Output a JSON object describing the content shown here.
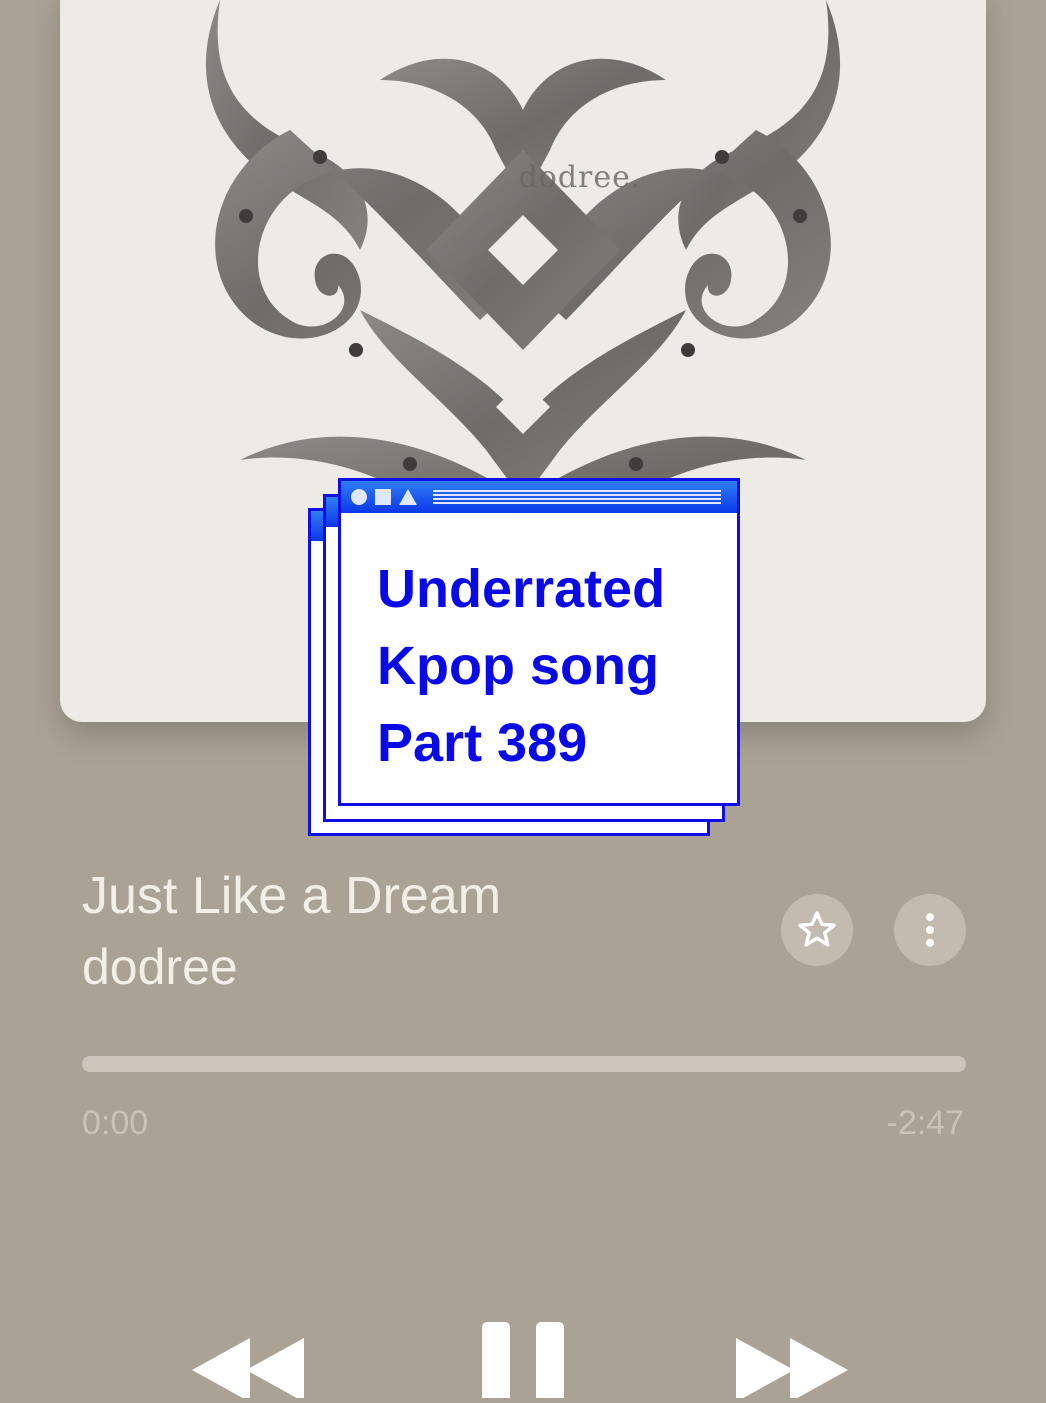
{
  "album_art": {
    "brand_text": "dodree.",
    "icon": "ornamental-metal-emblem"
  },
  "overlay": {
    "lines": [
      "Underrated",
      "Kpop song",
      "Part 389"
    ],
    "colors": {
      "text": "#0a0ae6",
      "border": "#1010e6",
      "bar": "#0b37e8"
    }
  },
  "track": {
    "title": "Just Like a Dream",
    "artist": "dodree"
  },
  "actions": {
    "favorite_icon": "star-icon",
    "more_icon": "more-vertical-icon"
  },
  "playback": {
    "progress": 0.0,
    "elapsed": "0:00",
    "remaining": "-2:47"
  },
  "controls": {
    "rewind_icon": "rewind-icon",
    "pause_icon": "pause-icon",
    "forward_icon": "fast-forward-icon"
  }
}
